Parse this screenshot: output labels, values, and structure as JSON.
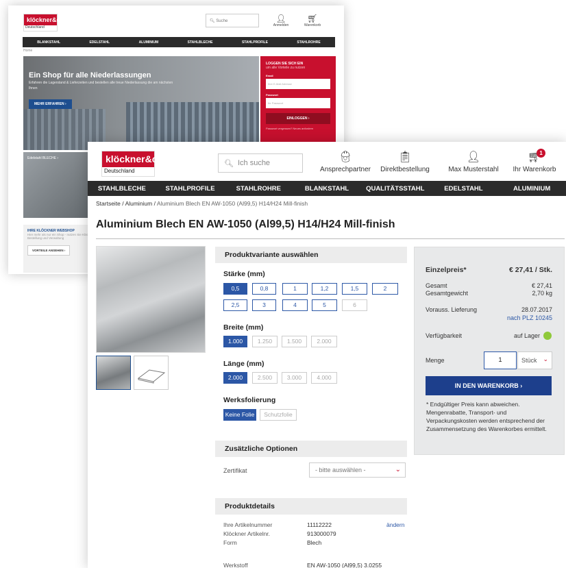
{
  "bg": {
    "logo_text": "klöckner&co",
    "logo_sub": "Deutschland",
    "search_placeholder": "Suche",
    "icons": [
      "Anmelden",
      "Warenkorb"
    ],
    "nav": [
      "BLANKSTAHL",
      "EDELSTAHL",
      "ALUMINIUM",
      "STAHLBLECHE",
      "STAHLPROFILE",
      "STAHLROHRE"
    ],
    "breadcrumb": "Home",
    "hero_title": "Ein Shop für alle Niederlassungen",
    "hero_text": "Erfahren die Lagerstand & Lieferzeiten und bestellen alle treue Niederlassung die am nächsten Ihnen",
    "hero_button": "MEHR ERFAHREN ›",
    "login_title": "LOGGEN SIE SICH EIN",
    "login_sub": "um alle Vorteile zu nutzen",
    "login_user_label": "Email",
    "login_user_ph": "Ihre E-Mail Adresse",
    "login_pw_label": "Passwort",
    "login_pw_ph": "Ihr Passwort",
    "login_button": "EINLOGGEN ›",
    "login_forgot": "Passwort vergessen? Neues anfordern",
    "tile_label": "Edelstahl BLECHE ›",
    "ws_title": "IHRE KLÖCKNER WEBSHOP",
    "ws_text": "Hier mehr als nur ein Shop - nutzen Sie Klöckner Bestellung und Verwaltung",
    "ws_button": "VORTEILE ANSEHEN ›"
  },
  "header": {
    "logo_text": "klöckner&co",
    "logo_sub": "Deutschland",
    "search_placeholder": "Ich suche",
    "contact": "Ansprechpartner",
    "direct": "Direktbestellung",
    "user": "Max Musterstahl",
    "cart": "Ihr Warenkorb",
    "cart_count": "1"
  },
  "nav": [
    "STAHLBLECHE",
    "STAHLPROFILE",
    "STAHLROHRE",
    "BLANKSTAHL",
    "QUALITÄTSSTAHL",
    "EDELSTAHL",
    "ALUMINIUM"
  ],
  "breadcrumb": {
    "b0": "Startseite",
    "b1": "Aluminium",
    "b2": "Aluminium Blech EN AW-1050 (Al99,5) H14/H24 Mill-finish",
    "sep": "/"
  },
  "title": "Aluminium Blech EN AW-1050 (Al99,5) H14/H24 Mill-finish",
  "variant": {
    "header": "Produktvariante auswählen",
    "staerke_label": "Stärke (mm)",
    "staerke": [
      "0,5",
      "0,8",
      "1",
      "1,2",
      "1,5",
      "2",
      "2,5",
      "3",
      "4",
      "5",
      "6"
    ],
    "breite_label": "Breite (mm)",
    "breite": [
      "1.000",
      "1.250",
      "1.500",
      "2.000"
    ],
    "laenge_label": "Länge (mm)",
    "laenge": [
      "2.000",
      "2.500",
      "3.000",
      "4.000"
    ],
    "folie_label": "Werksfolierung",
    "folie": [
      "Keine Folie",
      "Schutzfolie"
    ]
  },
  "options": {
    "header": "Zusätzliche Optionen",
    "zertifikat_label": "Zertifikat",
    "zertifikat_value": "- bitte auswählen -"
  },
  "details": {
    "header": "Produktdetails",
    "edit": "ändern",
    "labels": [
      "Ihre Artikelnummer",
      "Klöckner Artikelnr.",
      "Form"
    ],
    "values": [
      "11112222",
      "913000079",
      "Blech"
    ],
    "werkstoff_label": "Werkstoff",
    "werkstoff_value": "EN AW-1050 (Al99,5) 3.0255"
  },
  "price": {
    "label": "Einzelpreis*",
    "value": "€ 27,41 / Stk.",
    "gesamt_label": "Gesamt",
    "gesamt_value": "€ 27,41",
    "gewicht_label": "Gesamtgewicht",
    "gewicht_value": "2,70 kg",
    "lieferung_label": "Vorauss. Lieferung",
    "lieferung_date": "28.07.2017",
    "lieferung_plz": "nach PLZ 10245",
    "verf_label": "Verfügbarkeit",
    "verf_value": "auf Lager",
    "menge_label": "Menge",
    "menge_value": "1",
    "unit": "Stück",
    "cart_button": "IN DEN WARENKORB  ›",
    "note": "* Endgültiger Preis kann abweichen. Mengenrabatte, Transport- und Verpackungskosten werden entsprechend der Zusammensetzung des Warenkorbes ermittelt."
  },
  "colors": {
    "brand_red": "#c8102e",
    "selected_blue": "#2c57a6",
    "nav_dark": "#2b2b2b",
    "stock_green": "#8fc93a"
  }
}
